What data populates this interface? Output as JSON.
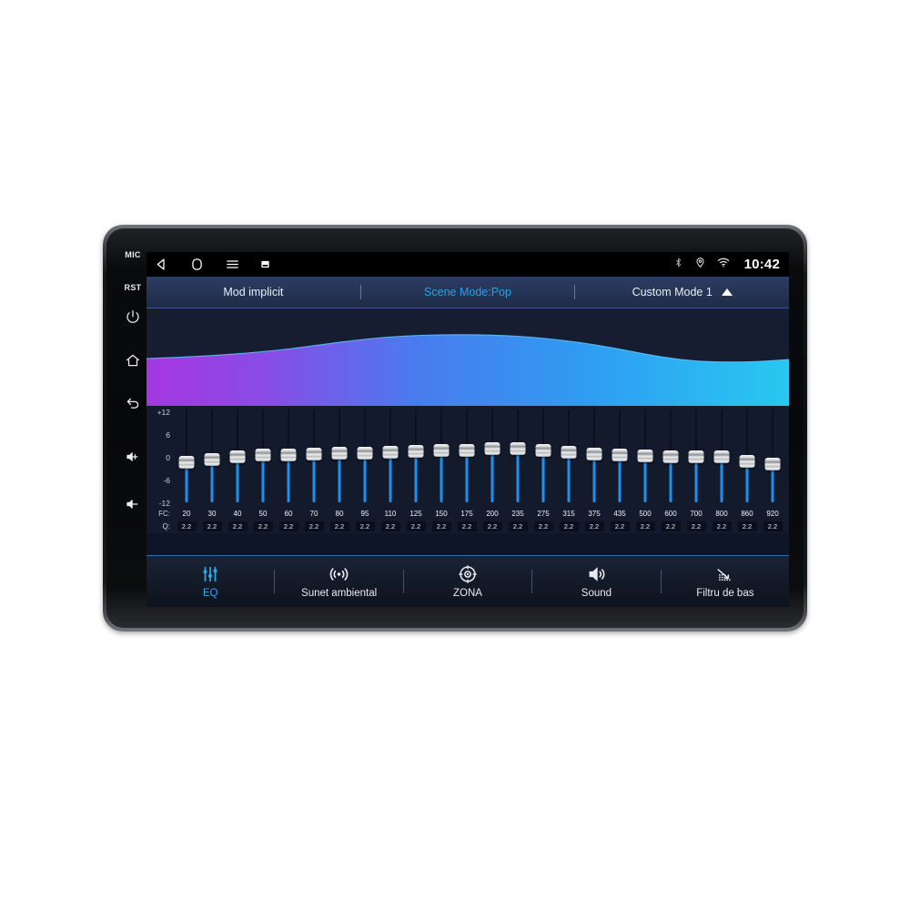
{
  "bezel": {
    "buttons": [
      {
        "name": "mic",
        "type": "text",
        "label": "MIC"
      },
      {
        "name": "reset",
        "type": "text",
        "label": "RST"
      },
      {
        "name": "power",
        "type": "icon",
        "icon": "power-icon"
      },
      {
        "name": "home",
        "type": "icon",
        "icon": "home-icon"
      },
      {
        "name": "back",
        "type": "icon",
        "icon": "back-arrow-icon"
      },
      {
        "name": "volume-up",
        "type": "icon",
        "icon": "volume-up-icon"
      },
      {
        "name": "volume-down",
        "type": "icon",
        "icon": "volume-down-icon"
      }
    ]
  },
  "statusbar": {
    "nav": [
      {
        "name": "back-icon",
        "label": "back"
      },
      {
        "name": "home-icon",
        "label": "home"
      },
      {
        "name": "menu-icon",
        "label": "menu"
      },
      {
        "name": "screenshot-icon",
        "label": "screenshot"
      }
    ],
    "indicators": [
      {
        "name": "bluetooth-icon",
        "label": "bluetooth"
      },
      {
        "name": "location-icon",
        "label": "location"
      },
      {
        "name": "wifi-icon",
        "label": "wifi"
      }
    ],
    "clock": "10:42"
  },
  "modebar": {
    "default_mode": "Mod implicit",
    "scene_mode": "Scene Mode:Pop",
    "custom_mode": "Custom Mode 1",
    "expand_icon": "triangle-up-icon",
    "accent_color": "#2f9fe8"
  },
  "eq": {
    "axis_labels": [
      "+12",
      "6",
      "0",
      "-6",
      "-12"
    ],
    "fc_row_label": "FC:",
    "q_row_label": "Q:",
    "range_db": [
      -12,
      12
    ],
    "slider_fill_color": "#1e90f0",
    "bands": [
      {
        "fc": "20",
        "q": "2.2",
        "gain": -1.6
      },
      {
        "fc": "30",
        "q": "2.2",
        "gain": -0.9
      },
      {
        "fc": "40",
        "q": "2.2",
        "gain": -0.3
      },
      {
        "fc": "50",
        "q": "2.2",
        "gain": 0.2
      },
      {
        "fc": "60",
        "q": "2.2",
        "gain": 0.3
      },
      {
        "fc": "70",
        "q": "2.2",
        "gain": 0.5
      },
      {
        "fc": "80",
        "q": "2.2",
        "gain": 0.6
      },
      {
        "fc": "95",
        "q": "2.2",
        "gain": 0.7
      },
      {
        "fc": "110",
        "q": "2.2",
        "gain": 1.0
      },
      {
        "fc": "125",
        "q": "2.2",
        "gain": 1.1
      },
      {
        "fc": "150",
        "q": "2.2",
        "gain": 1.3
      },
      {
        "fc": "175",
        "q": "2.2",
        "gain": 1.4
      },
      {
        "fc": "200",
        "q": "2.2",
        "gain": 2.0
      },
      {
        "fc": "235",
        "q": "2.2",
        "gain": 1.8
      },
      {
        "fc": "275",
        "q": "2.2",
        "gain": 1.5
      },
      {
        "fc": "315",
        "q": "2.2",
        "gain": 0.9
      },
      {
        "fc": "375",
        "q": "2.2",
        "gain": 0.5
      },
      {
        "fc": "435",
        "q": "2.2",
        "gain": 0.2
      },
      {
        "fc": "500",
        "q": "2.2",
        "gain": -0.1
      },
      {
        "fc": "600",
        "q": "2.2",
        "gain": -0.2
      },
      {
        "fc": "700",
        "q": "2.2",
        "gain": -0.2
      },
      {
        "fc": "800",
        "q": "2.2",
        "gain": -0.3
      },
      {
        "fc": "860",
        "q": "2.2",
        "gain": -1.3
      },
      {
        "fc": "920",
        "q": "2.2",
        "gain": -2.0
      }
    ]
  },
  "waveform": {
    "gradient_from": "#a537e0",
    "gradient_mid": "#3f7ef0",
    "gradient_to": "#28c8f0",
    "background": "#161d31"
  },
  "bottomnav": {
    "items": [
      {
        "name": "eq",
        "label": "EQ",
        "icon": "equalizer-icon",
        "active": true
      },
      {
        "name": "surround",
        "label": "Sunet ambiental",
        "icon": "surround-sound-icon",
        "active": false
      },
      {
        "name": "zona",
        "label": "ZONA",
        "icon": "target-zone-icon",
        "active": false
      },
      {
        "name": "sound",
        "label": "Sound",
        "icon": "speaker-icon",
        "active": false
      },
      {
        "name": "bass-filter",
        "label": "Filtru de bas",
        "icon": "bass-filter-icon",
        "active": false
      }
    ],
    "active_color": "#2fa8e8"
  }
}
